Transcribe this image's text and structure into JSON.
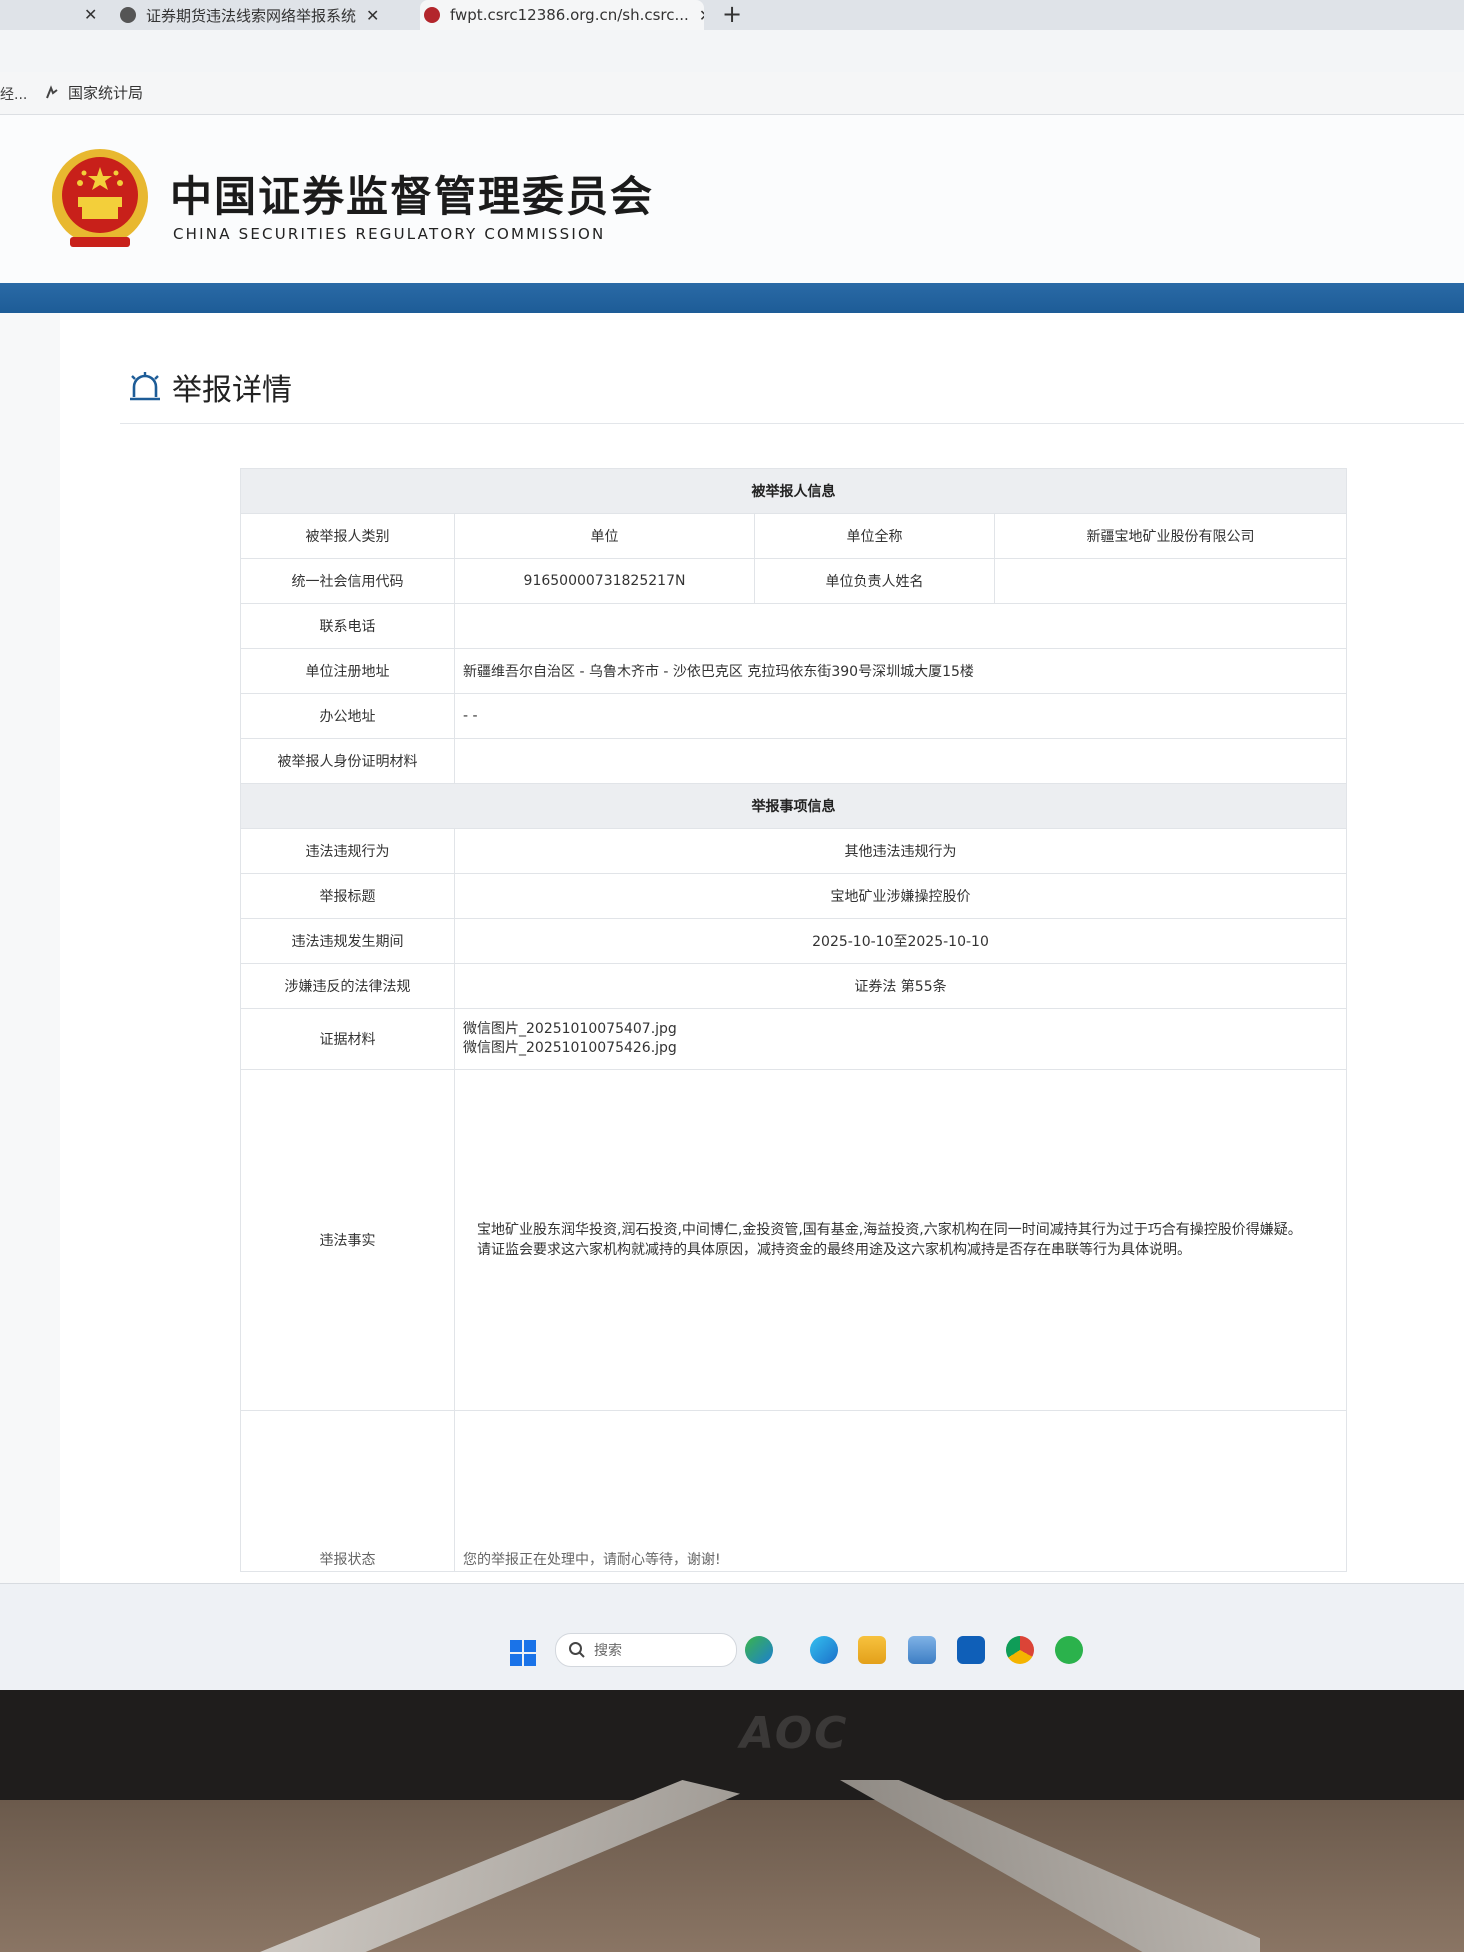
{
  "browser": {
    "tabs": [
      {
        "title": "证券期货违法线索网络举报系统",
        "close": "✕"
      },
      {
        "title": "fwpt.csrc12386.org.cn/sh.csrc...",
        "close": "✕"
      }
    ],
    "prev_tab_close": "✕",
    "new_tab": "+",
    "bookmarks": {
      "truncated": "经...",
      "item": "国家统计局"
    }
  },
  "site": {
    "title_cn": "中国证券监督管理委员会",
    "title_en": "CHINA SECURITIES REGULATORY COMMISSION",
    "colors": {
      "band": "#1f5f9b",
      "emblem_red": "#c8201a",
      "emblem_gold": "#e8b830"
    }
  },
  "page": {
    "section_title": "举报详情",
    "section_icon": "alarm-bell-icon"
  },
  "reported_party": {
    "header": "被举报人信息",
    "type_label": "被举报人类别",
    "type_value": "单位",
    "fullname_label": "单位全称",
    "fullname_value": "新疆宝地矿业股份有限公司",
    "credit_code_label": "统一社会信用代码",
    "credit_code_value": "91650000731825217N",
    "leader_label": "单位负责人姓名",
    "leader_value": "",
    "phone_label": "联系电话",
    "phone_value": "",
    "reg_address_label": "单位注册地址",
    "reg_address_value": "新疆维吾尔自治区 - 乌鲁木齐市 - 沙依巴克区 克拉玛依东街390号深圳城大厦15楼",
    "office_label": "办公地址",
    "office_value": "- -",
    "id_material_label": "被举报人身份证明材料",
    "id_material_value": ""
  },
  "report_matter": {
    "header": "举报事项信息",
    "behavior_label": "违法违规行为",
    "behavior_value": "其他违法违规行为",
    "title_label": "举报标题",
    "title_value": "宝地矿业涉嫌操控股价",
    "period_label": "违法违规发生期间",
    "period_value": "2025-10-10至2025-10-10",
    "law_label": "涉嫌违反的法律法规",
    "law_value": "证券法 第55条",
    "evidence_label": "证据材料",
    "evidence_files": [
      "微信图片_20251010075407.jpg",
      "微信图片_20251010075426.jpg"
    ],
    "facts_label": "违法事实",
    "facts_line1": "宝地矿业股东润华投资,润石投资,中间博仁,金投资管,国有基金,海益投资,六家机构在同一时间减持其行为过于巧合有操控股价得嫌疑。",
    "facts_line2": "请证监会要求这六家机构就减持的具体原因，减持资金的最终用途及这六家机构减持是否存在串联等行为具体说明。",
    "status_label": "举报状态",
    "status_value": "您的举报正在处理中，请耐心等待，谢谢!"
  },
  "taskbar": {
    "search_placeholder": "搜索",
    "apps": [
      "widgets-icon",
      "edge-icon",
      "file-explorer-icon",
      "photos-icon",
      "outlook-icon",
      "chrome-icon",
      "wechat-icon"
    ]
  },
  "monitor": {
    "brand": "AOC"
  }
}
